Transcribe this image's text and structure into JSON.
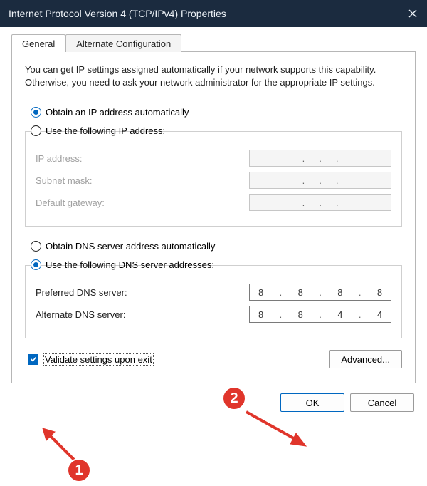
{
  "titlebar": {
    "title": "Internet Protocol Version 4 (TCP/IPv4) Properties"
  },
  "tabs": {
    "general": "General",
    "alternate": "Alternate Configuration"
  },
  "intro_text": "You can get IP settings assigned automatically if your network supports this capability. Otherwise, you need to ask your network administrator for the appropriate IP settings.",
  "ip_section": {
    "radio_auto": "Obtain an IP address automatically",
    "radio_manual": "Use the following IP address:",
    "ip_address_label": "IP address:",
    "subnet_label": "Subnet mask:",
    "gateway_label": "Default gateway:",
    "ip_address_value": "",
    "subnet_value": "",
    "gateway_value": ""
  },
  "dns_section": {
    "radio_auto": "Obtain DNS server address automatically",
    "radio_manual": "Use the following DNS server addresses:",
    "preferred_label": "Preferred DNS server:",
    "alternate_label": "Alternate DNS server:",
    "preferred_octets": [
      "8",
      "8",
      "8",
      "8"
    ],
    "alternate_octets": [
      "8",
      "8",
      "4",
      "4"
    ]
  },
  "validate_label": "Validate settings upon exit",
  "advanced_label": "Advanced...",
  "ok_label": "OK",
  "cancel_label": "Cancel",
  "annotations": {
    "badge1": "1",
    "badge2": "2"
  }
}
